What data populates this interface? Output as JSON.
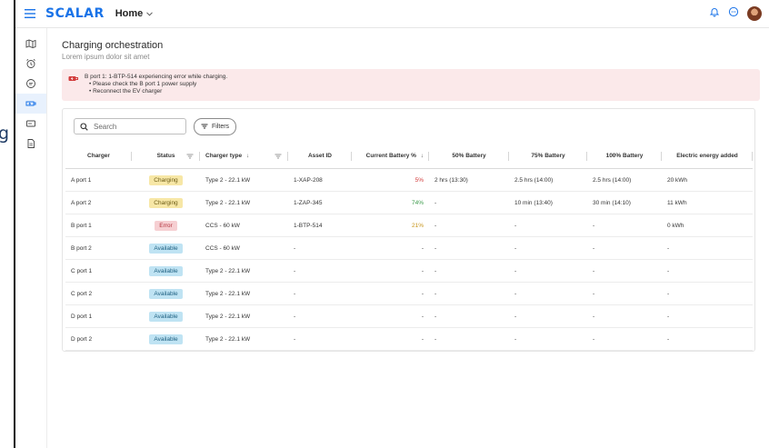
{
  "header": {
    "logo": "SCALAR",
    "nav_label": "Home"
  },
  "background_text": "g",
  "sidebar": {
    "items": [
      {
        "icon": "map-icon"
      },
      {
        "icon": "alarm-clock-icon"
      },
      {
        "icon": "chat-icon"
      },
      {
        "icon": "ev-charger-icon",
        "active": true
      },
      {
        "icon": "card-icon"
      },
      {
        "icon": "document-icon"
      }
    ]
  },
  "page": {
    "title": "Charging orchestration",
    "subtitle": "Lorem ipsum dolor sit amet"
  },
  "alert": {
    "message": "B port 1: 1-BTP-514 experiencing error while charging.",
    "bullets": [
      "Please check the B port 1 power supply",
      "Reconnect the EV charger"
    ]
  },
  "toolbar": {
    "search_placeholder": "Search",
    "filters_label": "Filters"
  },
  "table": {
    "columns": [
      "Charger",
      "Status",
      "Charger type",
      "Asset ID",
      "Current Battery %",
      "50% Battery",
      "75% Battery",
      "100% Battery",
      "Electric energy added"
    ],
    "rows": [
      {
        "charger": "A port 1",
        "status": "Charging",
        "type": "Type 2 - 22.1 kW",
        "asset": "1-XAP-208",
        "battery": "5%",
        "b50": "2 hrs (13:30)",
        "b75": "2.5 hrs (14:00)",
        "b100": "2.5 hrs (14:00)",
        "energy": "20 kWh"
      },
      {
        "charger": "A port 2",
        "status": "Charging",
        "type": "Type 2 - 22.1 kW",
        "asset": "1-ZAP-345",
        "battery": "74%",
        "b50": "-",
        "b75": "10 min (13:40)",
        "b100": "30 min (14:10)",
        "energy": "11 kWh"
      },
      {
        "charger": "B port 1",
        "status": "Error",
        "type": "CCS - 60 kW",
        "asset": "1-BTP-514",
        "battery": "21%",
        "b50": "-",
        "b75": "-",
        "b100": "-",
        "energy": "0 kWh"
      },
      {
        "charger": "B port 2",
        "status": "Available",
        "type": "CCS - 60 kW",
        "asset": "-",
        "battery": "-",
        "b50": "-",
        "b75": "-",
        "b100": "-",
        "energy": "-"
      },
      {
        "charger": "C port 1",
        "status": "Available",
        "type": "Type 2 - 22.1 kW",
        "asset": "-",
        "battery": "-",
        "b50": "-",
        "b75": "-",
        "b100": "-",
        "energy": "-"
      },
      {
        "charger": "C port 2",
        "status": "Available",
        "type": "Type 2 - 22.1 kW",
        "asset": "-",
        "battery": "-",
        "b50": "-",
        "b75": "-",
        "b100": "-",
        "energy": "-"
      },
      {
        "charger": "D port 1",
        "status": "Available",
        "type": "Type 2 - 22.1 kW",
        "asset": "-",
        "battery": "-",
        "b50": "-",
        "b75": "-",
        "b100": "-",
        "energy": "-"
      },
      {
        "charger": "D port 2",
        "status": "Available",
        "type": "Type 2 - 22.1 kW",
        "asset": "-",
        "battery": "-",
        "b50": "-",
        "b75": "-",
        "b100": "-",
        "energy": "-"
      }
    ]
  },
  "colors": {
    "brand": "#1a73e8",
    "status_charging_bg": "#f7e7a6",
    "status_charging_fg": "#6b5a14",
    "status_error_bg": "#f6cfd2",
    "status_error_fg": "#b3323c",
    "status_available_bg": "#bfe3f3",
    "status_available_fg": "#1d5f80",
    "battery_low": "#d23c3c",
    "battery_mid": "#c7941a",
    "battery_high": "#3b9a4a",
    "alert_bg": "#fbe9ea"
  }
}
